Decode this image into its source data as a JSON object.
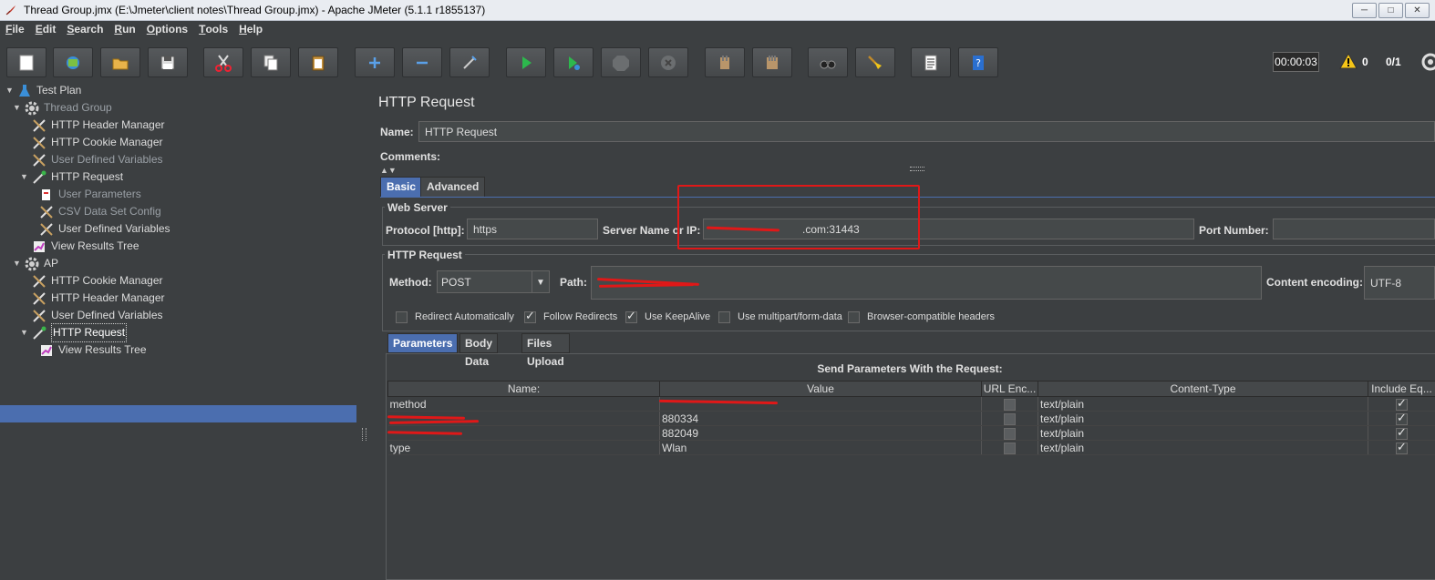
{
  "window": {
    "title": "Thread Group.jmx (E:\\Jmeter\\client notes\\Thread Group.jmx) - Apache JMeter (5.1.1 r1855137)"
  },
  "menu": [
    {
      "first": "F",
      "rest": "ile"
    },
    {
      "first": "E",
      "rest": "dit"
    },
    {
      "first": "S",
      "rest": "earch"
    },
    {
      "first": "R",
      "rest": "un"
    },
    {
      "first": "O",
      "rest": "ptions"
    },
    {
      "first": "T",
      "rest": "ools"
    },
    {
      "first": "H",
      "rest": "elp"
    }
  ],
  "status": {
    "timer": "00:00:03",
    "errors": "0",
    "threads": "0/1"
  },
  "tree": {
    "nodes": [
      {
        "label": "Test Plan",
        "icon": "test-plan-icon"
      },
      {
        "label": "Thread Group",
        "icon": "gear-icon"
      },
      {
        "label": "HTTP Header Manager",
        "icon": "wrench-icon"
      },
      {
        "label": "HTTP Cookie Manager",
        "icon": "wrench-icon"
      },
      {
        "label": "User Defined Variables",
        "icon": "wrench-icon"
      },
      {
        "label": "HTTP Request",
        "icon": "pipette-icon"
      },
      {
        "label": "User Parameters",
        "icon": "document-icon"
      },
      {
        "label": "CSV Data Set Config",
        "icon": "wrench-icon"
      },
      {
        "label": "User Defined Variables",
        "icon": "wrench-icon"
      },
      {
        "label": "View Results Tree",
        "icon": "chart-icon"
      },
      {
        "label": "AP",
        "icon": "gear-icon"
      },
      {
        "label": "HTTP Cookie Manager",
        "icon": "wrench-icon"
      },
      {
        "label": "HTTP Header Manager",
        "icon": "wrench-icon"
      },
      {
        "label": "User Defined Variables",
        "icon": "wrench-icon"
      },
      {
        "label": "HTTP Request",
        "icon": "pipette-icon"
      },
      {
        "label": "View Results Tree",
        "icon": "chart-icon"
      }
    ]
  },
  "panel": {
    "title": "HTTP Request",
    "name_label": "Name:",
    "name_value": "HTTP Request",
    "comments_label": "Comments:",
    "tabs": [
      "Basic",
      "Advanced"
    ],
    "web_server": {
      "title": "Web Server",
      "protocol_label": "Protocol [http]:",
      "protocol_value": "https",
      "server_label": "Server Name or IP:",
      "server_value": ".com:31443",
      "port_label": "Port Number:",
      "port_value": ""
    },
    "http_request": {
      "title": "HTTP Request",
      "method_label": "Method:",
      "method_value": "POST",
      "path_label": "Path:",
      "path_value": "",
      "encoding_label": "Content encoding:",
      "encoding_value": "UTF-8"
    },
    "checkboxes": [
      {
        "label": "Redirect Automatically",
        "checked": false
      },
      {
        "label": "Follow Redirects",
        "checked": true
      },
      {
        "label": "Use KeepAlive",
        "checked": true
      },
      {
        "label": "Use multipart/form-data",
        "checked": false
      },
      {
        "label": "Browser-compatible headers",
        "checked": false
      }
    ],
    "param_tabs": [
      "Parameters",
      "Body Data",
      "Files Upload"
    ],
    "params_title": "Send Parameters With the Request:",
    "columns": [
      "Name:",
      "Value",
      "URL Enc...",
      "Content-Type",
      "Include Eq..."
    ],
    "rows": [
      {
        "name": "method",
        "value": "",
        "url_enc": false,
        "content_type": "text/plain",
        "include_eq": true
      },
      {
        "name": "",
        "value": "880334",
        "url_enc": false,
        "content_type": "text/plain",
        "include_eq": true
      },
      {
        "name": "",
        "value": "882049",
        "url_enc": false,
        "content_type": "text/plain",
        "include_eq": true
      },
      {
        "name": "type",
        "value": "Wlan",
        "url_enc": false,
        "content_type": "text/plain",
        "include_eq": true
      }
    ]
  }
}
